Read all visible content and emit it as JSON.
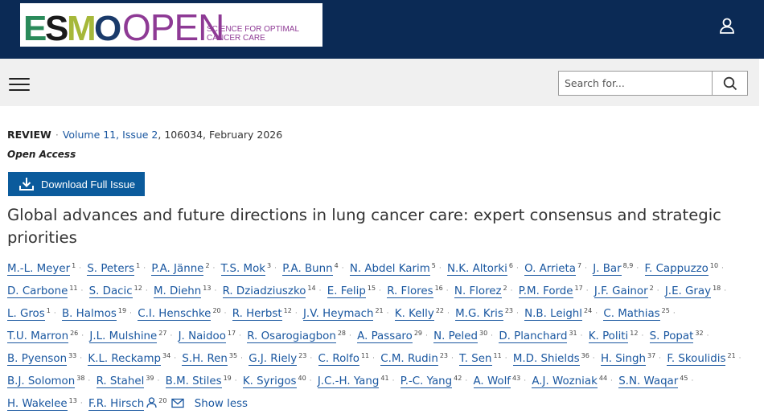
{
  "header": {
    "logo": {
      "brand": "ESMO",
      "product": "OPEN",
      "tagline_line1": "SCIENCE FOR OPTIMAL",
      "tagline_line2": "CANCER CARE"
    },
    "icons": {
      "user": "user-icon",
      "menu": "menu-icon",
      "search": "search-icon"
    },
    "colors": {
      "topbar": "#0b2a55",
      "subbar": "#f0f0f0",
      "link": "#1a57a0",
      "button": "#0b5b9c",
      "open_purple": "#8e3a95"
    }
  },
  "search": {
    "placeholder": "Search for..."
  },
  "article": {
    "type": "REVIEW",
    "separator": "·",
    "volume": "Volume 11, Issue 2",
    "citation": ", 106034, February 2026",
    "access": "Open Access",
    "download_label": "Download Full Issue",
    "title": "Global advances and future directions in lung cancer care: expert consensus and strategic priorities",
    "show_less": "Show less",
    "authors": [
      {
        "name": "M.-L. Meyer",
        "aff": "1"
      },
      {
        "name": "S. Peters",
        "aff": "1"
      },
      {
        "name": "P.A. Jänne",
        "aff": "2"
      },
      {
        "name": "T.S. Mok",
        "aff": "3"
      },
      {
        "name": "P.A. Bunn",
        "aff": "4"
      },
      {
        "name": "N. Abdel Karim",
        "aff": "5"
      },
      {
        "name": "N.K. Altorki",
        "aff": "6"
      },
      {
        "name": "O. Arrieta",
        "aff": "7"
      },
      {
        "name": "J. Bar",
        "aff": "8,9"
      },
      {
        "name": "F. Cappuzzo",
        "aff": "10"
      },
      {
        "name": "D. Carbone",
        "aff": "11"
      },
      {
        "name": "S. Dacic",
        "aff": "12"
      },
      {
        "name": "M. Diehn",
        "aff": "13"
      },
      {
        "name": "R. Dziadziuszko",
        "aff": "14"
      },
      {
        "name": "E. Felip",
        "aff": "15"
      },
      {
        "name": "R. Flores",
        "aff": "16"
      },
      {
        "name": "N. Florez",
        "aff": "2"
      },
      {
        "name": "P.M. Forde",
        "aff": "17"
      },
      {
        "name": "J.F. Gainor",
        "aff": "2"
      },
      {
        "name": "J.E. Gray",
        "aff": "18"
      },
      {
        "name": "L. Gros",
        "aff": "1"
      },
      {
        "name": "B. Halmos",
        "aff": "19"
      },
      {
        "name": "C.I. Henschke",
        "aff": "20"
      },
      {
        "name": "R. Herbst",
        "aff": "12"
      },
      {
        "name": "J.V. Heymach",
        "aff": "21"
      },
      {
        "name": "K. Kelly",
        "aff": "22"
      },
      {
        "name": "M.G. Kris",
        "aff": "23"
      },
      {
        "name": "N.B. Leighl",
        "aff": "24"
      },
      {
        "name": "C. Mathias",
        "aff": "25"
      },
      {
        "name": "T.U. Marron",
        "aff": "26"
      },
      {
        "name": "J.L. Mulshine",
        "aff": "27"
      },
      {
        "name": "J. Naidoo",
        "aff": "17"
      },
      {
        "name": "R. Osarogiagbon",
        "aff": "28"
      },
      {
        "name": "A. Passaro",
        "aff": "29"
      },
      {
        "name": "N. Peled",
        "aff": "30"
      },
      {
        "name": "D. Planchard",
        "aff": "31"
      },
      {
        "name": "K. Politi",
        "aff": "12"
      },
      {
        "name": "S. Popat",
        "aff": "32"
      },
      {
        "name": "B. Pyenson",
        "aff": "33"
      },
      {
        "name": "K.L. Reckamp",
        "aff": "34"
      },
      {
        "name": "S.H. Ren",
        "aff": "35"
      },
      {
        "name": "G.J. Riely",
        "aff": "23"
      },
      {
        "name": "C. Rolfo",
        "aff": "11"
      },
      {
        "name": "C.M. Rudin",
        "aff": "23"
      },
      {
        "name": "T. Sen",
        "aff": "11"
      },
      {
        "name": "M.D. Shields",
        "aff": "36"
      },
      {
        "name": "H. Singh",
        "aff": "37"
      },
      {
        "name": "F. Skoulidis",
        "aff": "21"
      },
      {
        "name": "B.J. Solomon",
        "aff": "38"
      },
      {
        "name": "R. Stahel",
        "aff": "39"
      },
      {
        "name": "B.M. Stiles",
        "aff": "19"
      },
      {
        "name": "K. Syrigos",
        "aff": "40"
      },
      {
        "name": "J.C.-H. Yang",
        "aff": "41"
      },
      {
        "name": "P.-C. Yang",
        "aff": "42"
      },
      {
        "name": "A. Wolf",
        "aff": "43"
      },
      {
        "name": "A.J. Wozniak",
        "aff": "44"
      },
      {
        "name": "S.N. Waqar",
        "aff": "45"
      },
      {
        "name": "H. Wakelee",
        "aff": "13"
      },
      {
        "name": "F.R. Hirsch",
        "aff": "20",
        "corresponding": true
      }
    ]
  }
}
